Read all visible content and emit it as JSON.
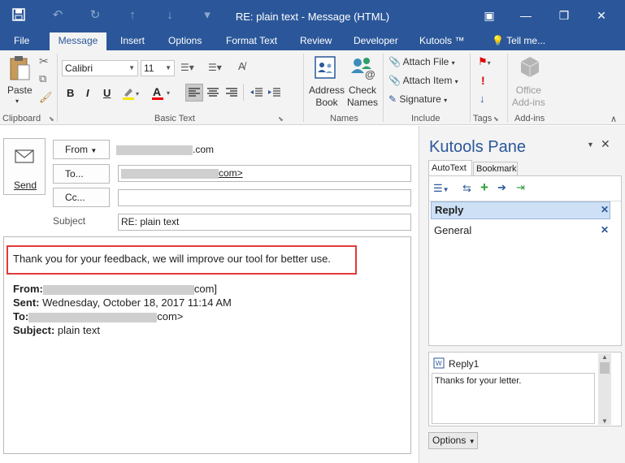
{
  "window": {
    "title": "RE: plain text - Message (HTML)"
  },
  "tabs": [
    "File",
    "Message",
    "Insert",
    "Options",
    "Format Text",
    "Review",
    "Developer",
    "Kutools ™",
    "Tell me..."
  ],
  "ribbon": {
    "clipboard": {
      "paste": "Paste",
      "label": "Clipboard"
    },
    "basic_text": {
      "font": "Calibri",
      "size": "11",
      "bold": "B",
      "italic": "I",
      "underline": "U",
      "label": "Basic Text"
    },
    "names": {
      "address_book": [
        "Address",
        "Book"
      ],
      "check_names": [
        "Check",
        "Names"
      ],
      "label": "Names"
    },
    "include": {
      "attach_file": "Attach File",
      "attach_item": "Attach Item",
      "signature": "Signature",
      "label": "Include"
    },
    "tags": {
      "label": "Tags"
    },
    "addins": {
      "office_addins": [
        "Office",
        "Add-ins"
      ],
      "label": "Add-ins"
    }
  },
  "compose": {
    "send": "Send",
    "from_button": "From",
    "from_value_suffix": ".com",
    "to_button": "To...",
    "to_value_suffix": "com>",
    "cc_button": "Cc...",
    "subject_label": "Subject",
    "subject_value": "RE: plain text",
    "body_reply": "Thank you for your feedback, we will improve our tool for better use.",
    "quote": {
      "from_label": "From:",
      "from_suffix": "com]",
      "sent_label": "Sent:",
      "sent_value": "Wednesday, October 18, 2017 11:14 AM",
      "to_label": "To:",
      "to_suffix": "com>",
      "subject_label": "Subject:",
      "subject_value": "plain text"
    }
  },
  "kutools_pane": {
    "title": "Kutools Pane",
    "tabs": [
      "AutoText",
      "Bookmark"
    ],
    "categories": [
      "Reply",
      "General"
    ],
    "entry_name": "Reply1",
    "preview": "Thanks for your letter.",
    "options": "Options"
  },
  "colors": {
    "accent": "#2b579a",
    "highlight_border": "#e03a3a",
    "selected_row": "#cde0f5"
  }
}
